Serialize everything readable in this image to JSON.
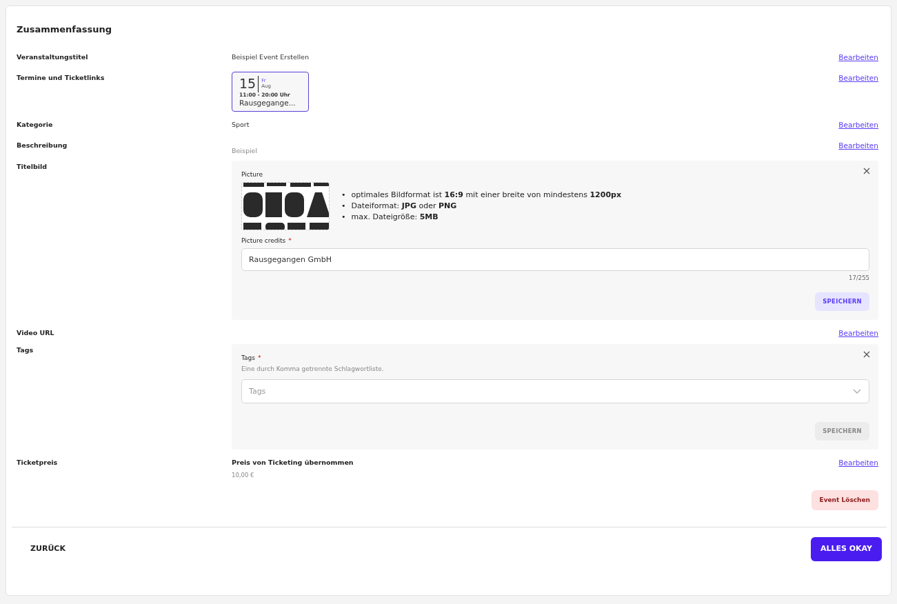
{
  "title": "Zusammenfassung",
  "rows": [
    {
      "kind": "text",
      "label": "Veranstaltungstitel",
      "value": "Beispiel Event Erstellen",
      "edit": "Bearbeiten"
    },
    {
      "kind": "dates",
      "label": "Termine und Ticketlinks",
      "dates": [
        {
          "day": "15",
          "weekday": "Fr",
          "month": "Aug",
          "time": "11:00 - 20:00 Uhr",
          "venue": "Rausgegange..."
        }
      ],
      "edit": "Bearbeiten"
    },
    {
      "kind": "text",
      "label": "Kategorie",
      "value": "Sport",
      "edit": "Bearbeiten"
    },
    {
      "kind": "description",
      "label": "Beschreibung",
      "value": "Beispiel",
      "edit": "Bearbeiten"
    },
    {
      "kind": "image_editor",
      "label": "Titelbild",
      "picture_label": "Picture",
      "hints": [
        {
          "bullet": "•",
          "text": "optimales Bildformat ist **16:9** mit einer breite von mindestens **1200px**"
        },
        {
          "bullet": "•",
          "text": "Dateiformat: **JPG** oder **PNG**"
        },
        {
          "bullet": "•",
          "text": "max. Dateigröße: **5MB**"
        }
      ],
      "credits": {
        "label": "Picture credits",
        "required_mark": "*",
        "value": "Rausgegangen GmbH",
        "counter": "17/255"
      },
      "save": {
        "label": "SPEICHERN",
        "disabled": false
      }
    },
    {
      "kind": "empty",
      "label": "Video URL",
      "edit": "Bearbeiten"
    },
    {
      "kind": "tags_editor",
      "label": "Tags",
      "field": {
        "label": "Tags",
        "required_mark": "*",
        "help": "Eine durch Komma getrennte Schlagwortliste.",
        "placeholder": "Tags"
      },
      "save": {
        "label": "SPEICHERN",
        "disabled": true
      }
    },
    {
      "kind": "price",
      "label": "Ticketpreis",
      "title": "Preis von Ticketing übernommen",
      "value": "10,00 €",
      "edit": "Bearbeiten"
    }
  ],
  "delete_button": "Event Löschen",
  "back_button": "ZURÜCK",
  "confirm_button": "ALLES OKAY"
}
